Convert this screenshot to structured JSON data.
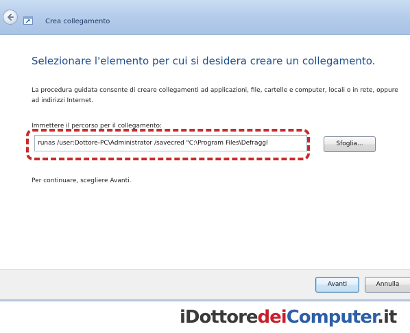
{
  "window": {
    "title": "Crea collegamento",
    "back_icon": "back-arrow-icon",
    "wizard_icon": "shortcut-wizard-icon"
  },
  "main": {
    "heading": "Selezionare l'elemento per cui si desidera creare un collegamento.",
    "description": "La procedura guidata consente di creare collegamenti ad applicazioni, file, cartelle e computer, locali o in rete, oppure ad indirizzi Internet.",
    "field_label": "Immettere il percorso per il collegamento:",
    "path_value": "runas /user:Dottore-PC\\Administrator /savecred \"C:\\Program Files\\Defraggl",
    "browse_label": "Sfoglia...",
    "hint": "Per continuare, scegliere Avanti."
  },
  "footer": {
    "next_label": "Avanti",
    "cancel_label": "Annulla"
  },
  "watermark": {
    "part1": "iDottore",
    "part2": "dei",
    "part3": "Computer",
    "part4": ".it"
  },
  "colors": {
    "heading": "#1d4f91",
    "highlight": "#c82b2b",
    "titlebar": "#b3cbe9"
  }
}
